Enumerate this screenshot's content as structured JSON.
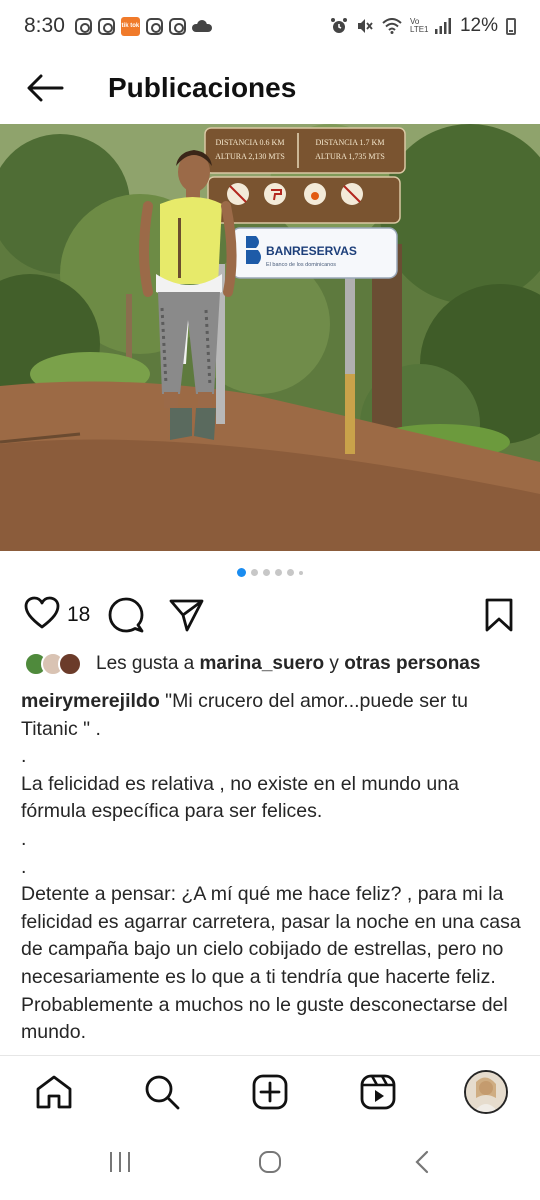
{
  "status_bar": {
    "time": "8:30",
    "orange_app_text": "tik tok",
    "network": "Vo LTE1",
    "battery": "12%"
  },
  "header": {
    "title": "Publicaciones"
  },
  "carousel": {
    "total_dots": 6,
    "active_index": 0
  },
  "actions": {
    "like_count": "18"
  },
  "likes": {
    "prefix": "Les gusta a ",
    "user": "marina_suero",
    "connector": " y ",
    "others": "otras personas"
  },
  "caption": {
    "username": "meirymerejildo",
    "line1": " \"Mi crucero del amor...puede ser tu Titanic \" .",
    "dot1": ".",
    "para2": "La felicidad es relativa , no existe en el mundo una fórmula específica para ser felices.",
    "dot2": ".",
    "dot3": ".",
    "para3": "Detente a pensar: ¿A mí qué me hace feliz? , para mi la felicidad es agarrar carretera,  pasar la noche en una casa de campaña  bajo un cielo cobijado de estrellas,  pero no necesariamente es lo que a ti tendría que hacerte feliz. Probablemente a muchos no le guste desconectarse del mundo."
  },
  "sign": {
    "dist1": "DISTANCIA 0.6 KM",
    "alt1": "ALTURA 2,130 MTS",
    "dist2": "DISTANCIA 1.7 KM",
    "alt2": "ALTURA 1,735 MTS",
    "brand": "BANRESERVAS",
    "brand_sub": "El banco de los dominicanos"
  },
  "colors": {
    "accent_blue": "#1a8cf0",
    "text": "#262626"
  }
}
